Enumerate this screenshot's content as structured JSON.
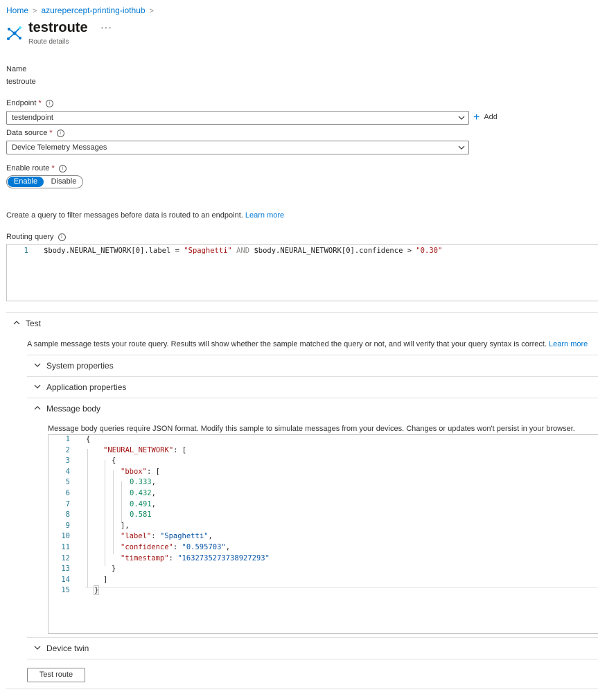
{
  "breadcrumb": {
    "items": [
      "Home",
      "azurepercept-printing-iothub"
    ]
  },
  "header": {
    "title": "testroute",
    "subtitle": "Route details",
    "more": "···",
    "icon": "route-icon"
  },
  "name": {
    "label": "Name",
    "value": "testroute"
  },
  "endpoint": {
    "label": "Endpoint",
    "required": "*",
    "value": "testendpoint",
    "add_label": "Add"
  },
  "data_source": {
    "label": "Data source",
    "required": "*",
    "value": "Device Telemetry Messages"
  },
  "enable_route": {
    "label": "Enable route",
    "required": "*",
    "enable_label": "Enable",
    "disable_label": "Disable",
    "selected": "Enable"
  },
  "query_intro": {
    "text": "Create a query to filter messages before data is routed to an endpoint.",
    "link": "Learn more"
  },
  "routing_query": {
    "label": "Routing query",
    "line_number": "1",
    "parts": [
      "$body.NEURAL_NETWORK[0].label = ",
      "\"Spaghetti\"",
      " AND ",
      "$body.NEURAL_NETWORK[0].confidence > ",
      "\"0.30\""
    ]
  },
  "test": {
    "title": "Test",
    "description": "A sample message tests your route query. Results will show whether the sample matched the query or not, and will verify that your query syntax is correct.",
    "link": "Learn more",
    "sections": {
      "system": "System properties",
      "application": "Application properties",
      "message_body": "Message body",
      "device_twin": "Device twin"
    },
    "message_note": "Message body queries require JSON format. Modify this sample to simulate messages from your devices. Changes or updates won't persist in your browser.",
    "body_lines": [
      "1",
      "2",
      "3",
      "4",
      "5",
      "6",
      "7",
      "8",
      "9",
      "10",
      "11",
      "12",
      "13",
      "14",
      "15"
    ],
    "json": {
      "l1": "{",
      "l2_key": "\"NEURAL_NETWORK\"",
      "l2_rest": ": [",
      "l3": "{",
      "l4_key": "\"bbox\"",
      "l4_rest": ": [",
      "l5": "0.333",
      "l6": "0.432",
      "l7": "0.491",
      "l8": "0.581",
      "l9": "],",
      "l10_key": "\"label\"",
      "l10_val": "\"Spaghetti\"",
      "l11_key": "\"confidence\"",
      "l11_val": "\"0.595703\"",
      "l12_key": "\"timestamp\"",
      "l12_val": "\"1632735273738927293\"",
      "l13": "}",
      "l14": "]",
      "l15": "}"
    },
    "button": "Test route"
  }
}
